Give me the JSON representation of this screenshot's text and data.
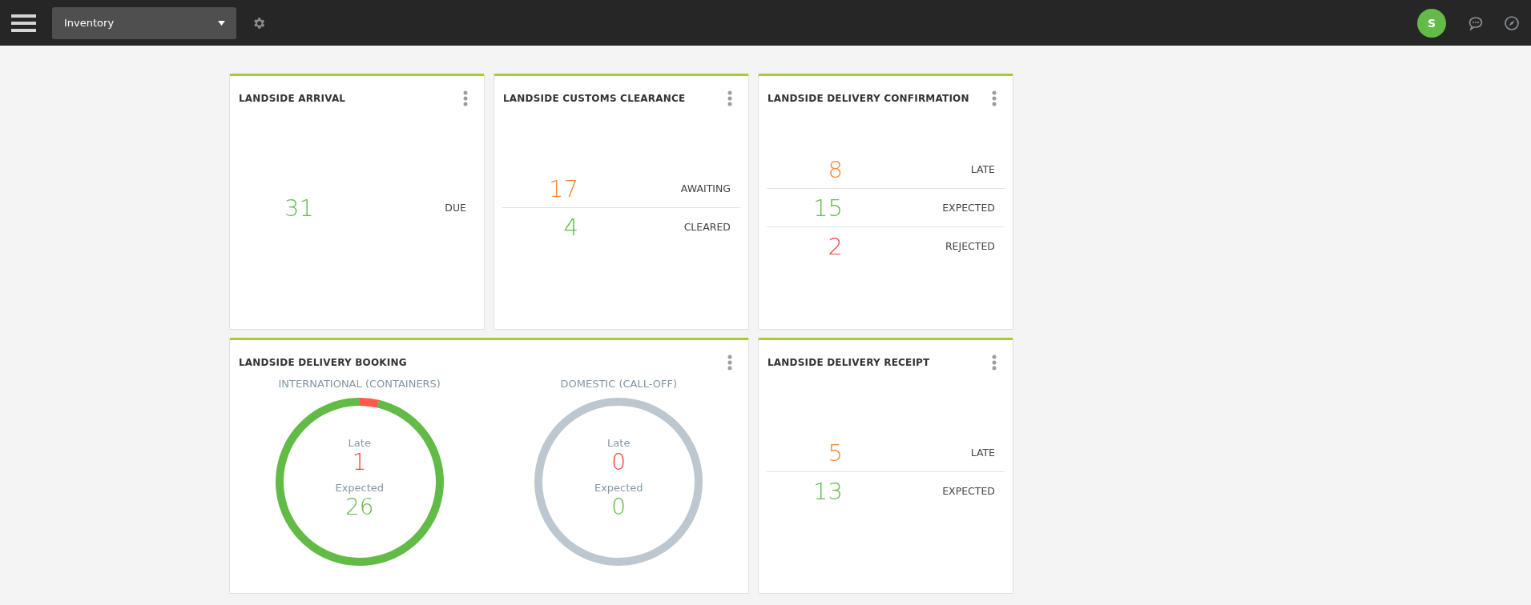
{
  "top_bar": {
    "dropdown": {
      "value": "Inventory"
    },
    "avatar": {
      "initial": "S"
    }
  },
  "widgets": [
    {
      "kind": "metrics",
      "title": "LANDSIDE ARRIVAL",
      "metrics": [
        {
          "value": "31",
          "label": "DUE",
          "color": "#62bb46"
        }
      ]
    },
    {
      "kind": "metrics",
      "title": "LANDSIDE CUSTOMS CLEARANCE",
      "metrics": [
        {
          "value": "17",
          "label": "AWAITING",
          "color": "#f5883a"
        },
        {
          "value": "4",
          "label": "CLEARED",
          "color": "#62bb46"
        }
      ]
    },
    {
      "kind": "metrics",
      "title": "LANDSIDE DELIVERY CONFIRMATION",
      "metrics": [
        {
          "value": "8",
          "label": "LATE",
          "color": "#f5883a"
        },
        {
          "value": "15",
          "label": "EXPECTED",
          "color": "#62bb46"
        },
        {
          "value": "2",
          "label": "REJECTED",
          "color": "#f0463c"
        }
      ]
    },
    {
      "kind": "donuts",
      "title": "LANDSIDE DELIVERY BOOKING",
      "donuts": [
        {
          "title": "INTERNATIONAL (CONTAINERS)",
          "stats": [
            {
              "label": "Late",
              "value": "1",
              "color": "#f0463c"
            },
            {
              "label": "Expected",
              "value": "26",
              "color": "#62bb46"
            }
          ]
        },
        {
          "title": "DOMESTIC (CALL-OFF)",
          "stats": [
            {
              "label": "Late",
              "value": "0",
              "color": "#f0463c"
            },
            {
              "label": "Expected",
              "value": "0",
              "color": "#62bb46"
            }
          ]
        }
      ]
    },
    {
      "kind": "metrics",
      "title": "LANDSIDE DELIVERY RECEIPT",
      "metrics": [
        {
          "value": "5",
          "label": "LATE",
          "color": "#f5883a"
        },
        {
          "value": "13",
          "label": "EXPECTED",
          "color": "#62bb46"
        }
      ]
    }
  ]
}
